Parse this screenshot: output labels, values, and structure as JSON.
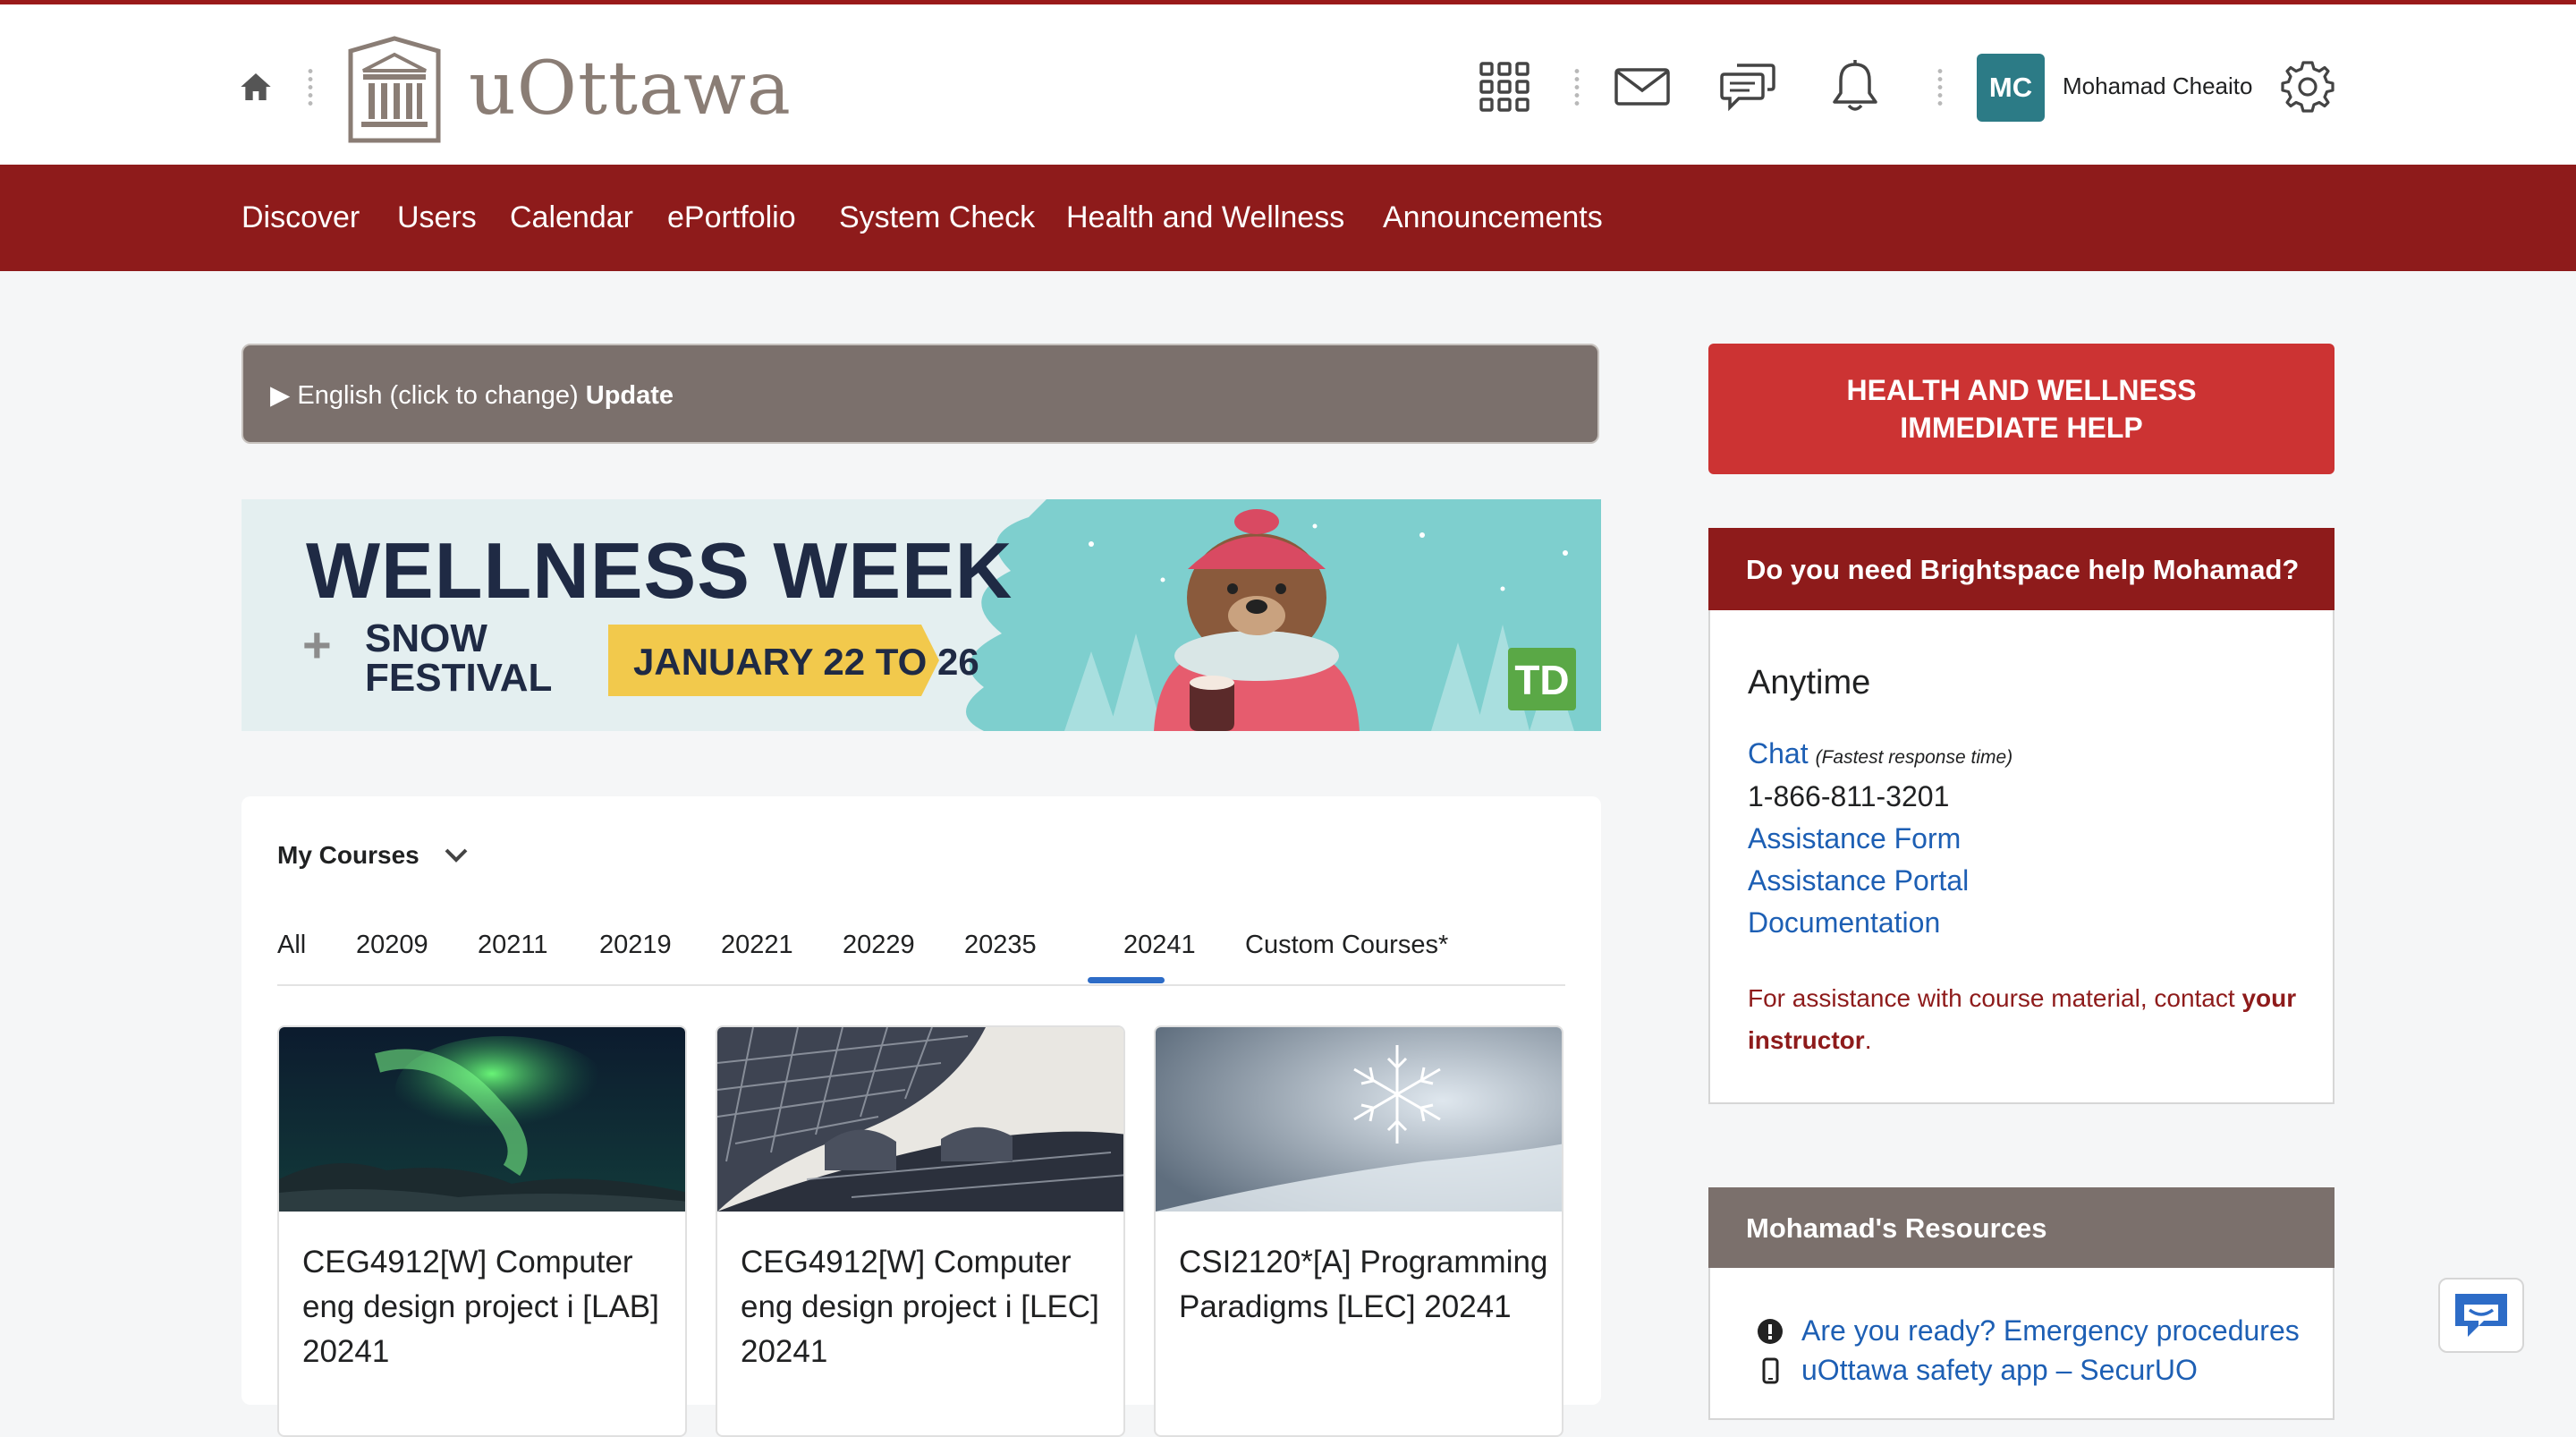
{
  "header": {
    "logo_text": "uOttawa",
    "user_initials": "MC",
    "user_name": "Mohamad Cheaito",
    "colors": {
      "brand_red": "#8e1b1b",
      "avatar": "#2c7b86"
    }
  },
  "nav": {
    "items": [
      "Discover",
      "Users",
      "Calendar",
      "ePortfolio",
      "System Check",
      "Health and Wellness",
      "Announcements"
    ]
  },
  "language": {
    "text": "▶ English (click to change)",
    "update_label": "Update"
  },
  "banner": {
    "title": "WELLNESS WEEK",
    "plus": "+",
    "subtitle_line1": "SNOW",
    "subtitle_line2": "FESTIVAL",
    "dates": "JANUARY 22 TO 26",
    "sponsor": "TD"
  },
  "courses": {
    "title": "My Courses",
    "tabs": [
      "All",
      "20209",
      "20211",
      "20219",
      "20221",
      "20229",
      "20235",
      "20241",
      "Custom Courses*"
    ],
    "selected_tab": "20241",
    "tiles": [
      {
        "name": "CEG4912[W] Computer eng design project i [LAB] 20241",
        "image": "aurora"
      },
      {
        "name": "CEG4912[W] Computer eng design project i [LEC] 20241",
        "image": "eiffel-tower"
      },
      {
        "name": "CSI2120*[A] Programming Paradigms [LEC] 20241",
        "image": "snowflake"
      }
    ]
  },
  "health_button": {
    "line1": "HEALTH AND WELLNESS",
    "line2": "IMMEDIATE HELP"
  },
  "help": {
    "title": "Do you need Brightspace help Mohamad?",
    "anytime": "Anytime",
    "chat": "Chat",
    "chat_note": "(Fastest response time)",
    "phone": "1-866-811-3201",
    "assistance_form": "Assistance Form",
    "assistance_portal": "Assistance Portal",
    "documentation": "Documentation",
    "assist_text": "For assistance with course material, contact",
    "assist_bold": "your instructor",
    "assist_end": "."
  },
  "resources": {
    "title": "Mohamad's Resources",
    "items": [
      "Are you ready? Emergency procedures",
      "uOttawa safety app – SecurUO"
    ]
  }
}
